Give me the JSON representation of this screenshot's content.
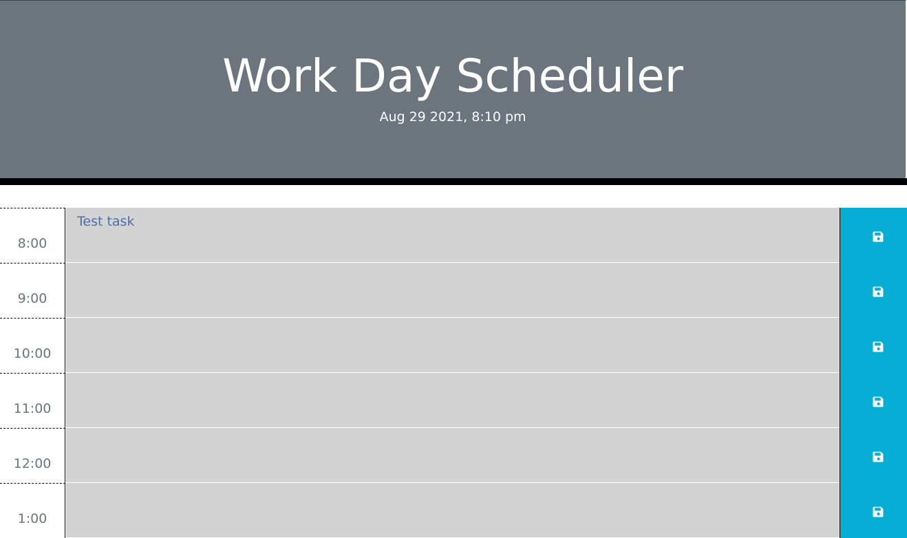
{
  "header": {
    "title": "Work Day Scheduler",
    "current_datetime": "Aug 29 2021, 8:10 pm"
  },
  "colors": {
    "header_bg": "#6c757d",
    "divider": "#000000",
    "task_bg": "#d3d3d3",
    "task_text": "#4a6fa5",
    "hour_text": "#6c757d",
    "save_bg": "#06aed5",
    "save_icon": "#ffffff"
  },
  "time_blocks": [
    {
      "hour": "8:00",
      "task": "Test task",
      "save_icon": "floppy-disk-icon"
    },
    {
      "hour": "9:00",
      "task": "",
      "save_icon": "floppy-disk-icon"
    },
    {
      "hour": "10:00",
      "task": "",
      "save_icon": "floppy-disk-icon"
    },
    {
      "hour": "11:00",
      "task": "",
      "save_icon": "floppy-disk-icon"
    },
    {
      "hour": "12:00",
      "task": "",
      "save_icon": "floppy-disk-icon"
    },
    {
      "hour": "1:00",
      "task": "",
      "save_icon": "floppy-disk-icon"
    }
  ]
}
